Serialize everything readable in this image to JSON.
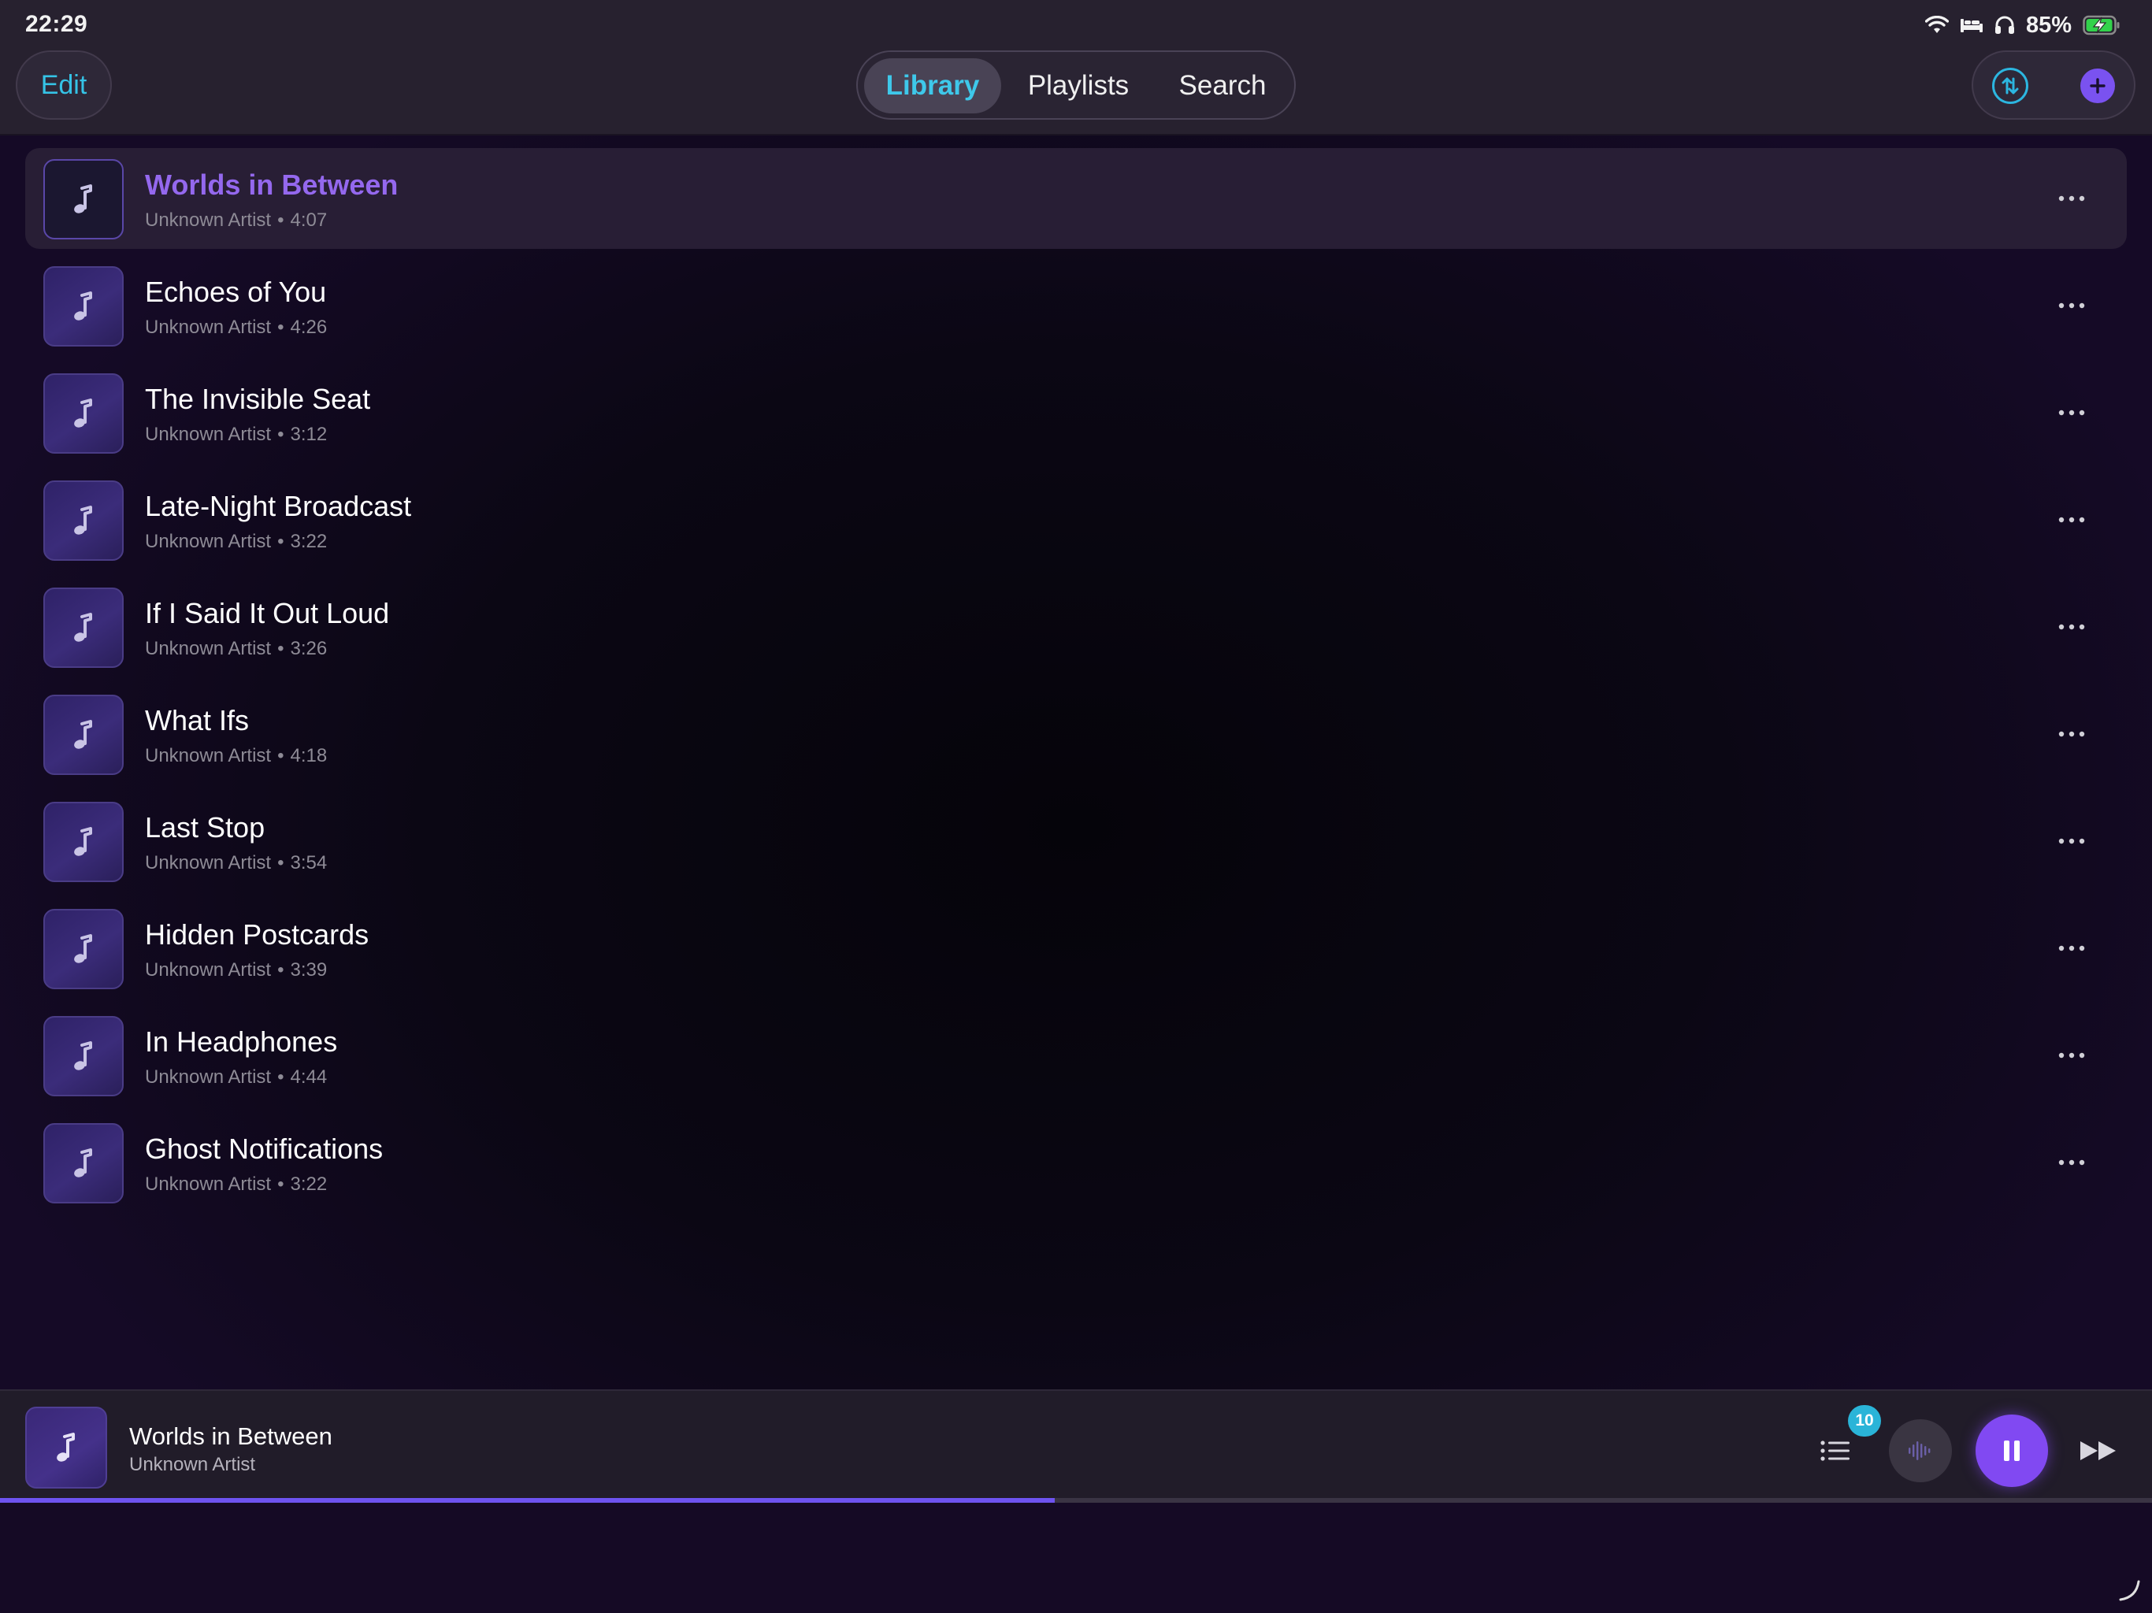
{
  "status_bar": {
    "time": "22:29",
    "battery_percent": "85%",
    "icons": [
      "wifi-icon",
      "bed-icon",
      "headphones-icon",
      "battery-charging-icon"
    ]
  },
  "toolbar": {
    "edit_label": "Edit",
    "tabs": [
      {
        "label": "Library",
        "active": true
      },
      {
        "label": "Playlists",
        "active": false
      },
      {
        "label": "Search",
        "active": false
      }
    ],
    "sort_icon": "sort-arrows-icon",
    "add_icon": "plus-icon"
  },
  "tracks": [
    {
      "title": "Worlds in Between",
      "artist": "Unknown Artist",
      "separator": "•",
      "duration": "4:07",
      "playing": true
    },
    {
      "title": "Echoes of You",
      "artist": "Unknown Artist",
      "separator": "•",
      "duration": "4:26"
    },
    {
      "title": "The Invisible Seat",
      "artist": "Unknown Artist",
      "separator": "•",
      "duration": "3:12"
    },
    {
      "title": "Late-Night Broadcast",
      "artist": "Unknown Artist",
      "separator": "•",
      "duration": "3:22"
    },
    {
      "title": "If I Said It Out Loud",
      "artist": "Unknown Artist",
      "separator": "•",
      "duration": "3:26"
    },
    {
      "title": "What Ifs",
      "artist": "Unknown Artist",
      "separator": "•",
      "duration": "4:18"
    },
    {
      "title": "Last Stop",
      "artist": "Unknown Artist",
      "separator": "•",
      "duration": "3:54"
    },
    {
      "title": "Hidden Postcards",
      "artist": "Unknown Artist",
      "separator": "•",
      "duration": "3:39"
    },
    {
      "title": "In Headphones",
      "artist": "Unknown Artist",
      "separator": "•",
      "duration": "4:44"
    },
    {
      "title": "Ghost Notifications",
      "artist": "Unknown Artist",
      "separator": "•",
      "duration": "3:22"
    }
  ],
  "now_playing": {
    "title": "Worlds in Between",
    "artist": "Unknown Artist",
    "queue_count": "10",
    "progress_fraction": 0.49
  },
  "colors": {
    "accent_cyan": "#35c3e6",
    "accent_purple": "#8149f2",
    "playing_title": "#9468ee",
    "background": "#0c0814"
  }
}
